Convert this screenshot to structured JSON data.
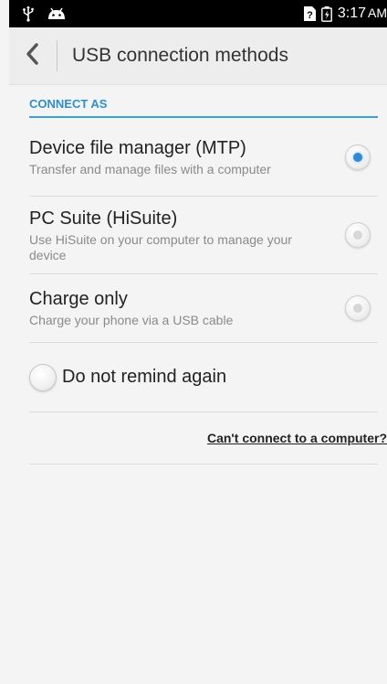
{
  "status_bar": {
    "time": "3:17",
    "ampm": "AM",
    "icons": [
      "usb-icon",
      "android-debug-icon",
      "no-sim-icon",
      "battery-charging-icon"
    ]
  },
  "app_bar": {
    "title": "USB connection methods",
    "back_icon": "chevron-left-icon"
  },
  "section": {
    "header": "CONNECT AS"
  },
  "options": [
    {
      "title": "Device file manager (MTP)",
      "subtitle": "Transfer and manage files with a computer",
      "selected": true
    },
    {
      "title": "PC Suite (HiSuite)",
      "subtitle": "Use HiSuite on your computer to manage your device",
      "selected": false
    },
    {
      "title": "Charge only",
      "subtitle": "Charge your phone via a USB cable",
      "selected": false
    }
  ],
  "remind": {
    "label": "Do not remind again",
    "checked": false
  },
  "help_link": "Can't connect to a computer?",
  "colors": {
    "accent": "#2f8ad6",
    "background": "#f4f4f4",
    "app_bar": "#ededed"
  }
}
